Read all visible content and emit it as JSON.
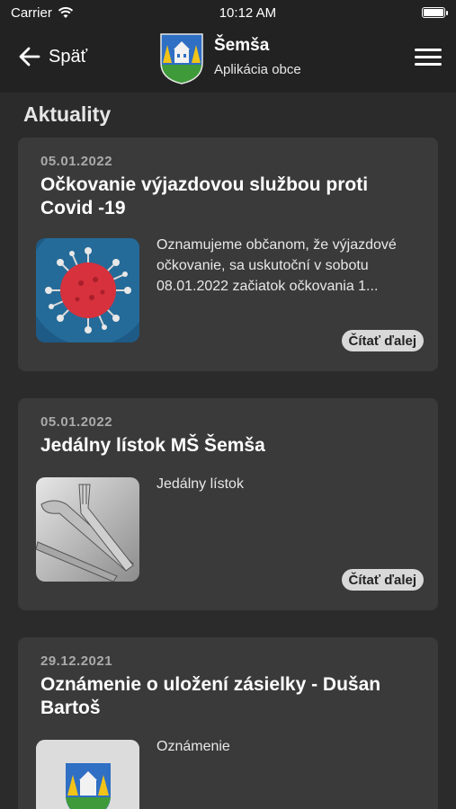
{
  "statusbar": {
    "carrier": "Carrier",
    "time": "10:12 AM",
    "battery_level": 1.0
  },
  "navbar": {
    "back_label": "Späť",
    "title": "Šemša",
    "subtitle": "Aplikácia obce"
  },
  "section_title": "Aktuality",
  "colors": {
    "background": "#2b2b2b",
    "bar": "#222222",
    "card": "#3a3a3a",
    "read_more_bg": "#d8d8d8"
  },
  "articles": [
    {
      "date": "05.01.2022",
      "title": "Očkovanie výjazdovou službou proti Covid -19",
      "excerpt": "Oznamujeme občanom, že výjazdové očkovanie,  sa uskutoční v sobotu 08.01.2022 začiatok očkovania 1...",
      "read_more": "Čítať ďalej",
      "thumb_icon": "virus-image"
    },
    {
      "date": "05.01.2022",
      "title": "Jedálny lístok MŠ Šemša",
      "excerpt": "Jedálny lístok",
      "read_more": "Čítať ďalej",
      "thumb_icon": "cutlery-image"
    },
    {
      "date": "29.12.2021",
      "title": "Oznámenie o uložení zásielky - Dušan Bartoš",
      "excerpt": "Oznámenie",
      "thumb_icon": "coat-of-arms-image"
    }
  ]
}
